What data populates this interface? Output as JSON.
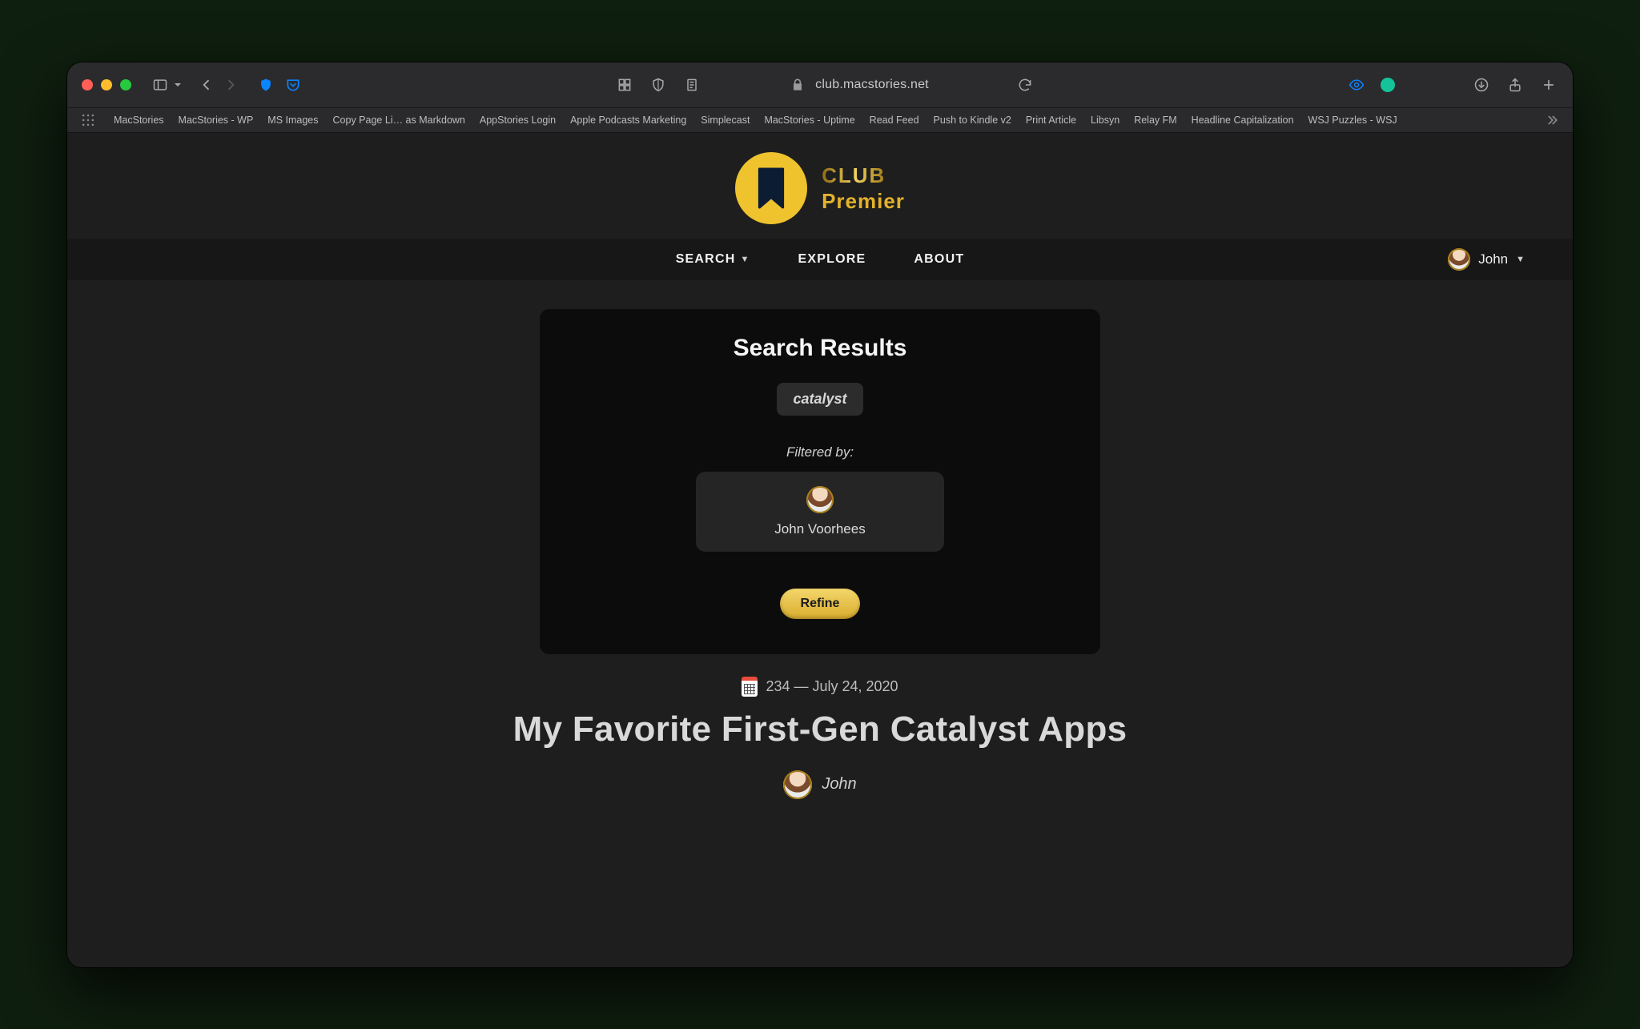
{
  "browser": {
    "url": "club.macstories.net",
    "bookmarks": [
      "MacStories",
      "MacStories - WP",
      "MS Images",
      "Copy Page Li… as Markdown",
      "AppStories Login",
      "Apple Podcasts Marketing",
      "Simplecast",
      "MacStories - Uptime",
      "Read Feed",
      "Push to Kindle v2",
      "Print Article",
      "Libsyn",
      "Relay FM",
      "Headline Capitalization",
      "WSJ Puzzles - WSJ"
    ]
  },
  "logo": {
    "line1": "CLUB",
    "line2": "Premier"
  },
  "nav": {
    "search": "SEARCH",
    "explore": "EXPLORE",
    "about": "ABOUT",
    "user": "John"
  },
  "panel": {
    "heading": "Search Results",
    "query": "catalyst",
    "filtered_label": "Filtered by:",
    "filter_name": "John Voorhees",
    "refine": "Refine"
  },
  "result": {
    "issue_meta": "234 — July 24, 2020",
    "title": "My Favorite First-Gen Catalyst Apps",
    "author": "John"
  }
}
